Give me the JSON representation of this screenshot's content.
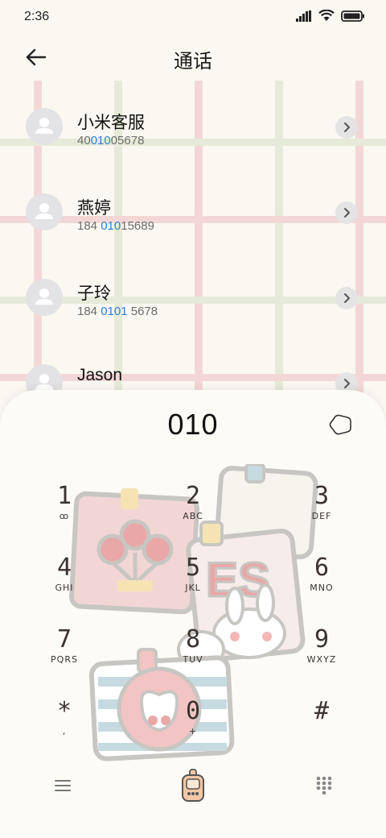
{
  "status": {
    "time": "2:36"
  },
  "header": {
    "title": "通话"
  },
  "contacts": [
    {
      "name": "小米客服",
      "num_pre": "40",
      "num_hl": "010",
      "num_post": "05678"
    },
    {
      "name": "燕婷",
      "num_pre": "184 ",
      "num_hl": "010",
      "num_post": "15689"
    },
    {
      "name": "子玲",
      "num_pre": "184 ",
      "num_hl": "0101",
      "num_post": " 5678"
    },
    {
      "name": "Jason",
      "num_pre": "",
      "num_hl": "",
      "num_post": ""
    }
  ],
  "dialpad": {
    "input": "010",
    "keys": [
      {
        "num": "1",
        "letters": "ꝏ"
      },
      {
        "num": "2",
        "letters": "ABC"
      },
      {
        "num": "3",
        "letters": "DEF"
      },
      {
        "num": "4",
        "letters": "GHI"
      },
      {
        "num": "5",
        "letters": "JKL"
      },
      {
        "num": "6",
        "letters": "MNO"
      },
      {
        "num": "7",
        "letters": "PQRS"
      },
      {
        "num": "8",
        "letters": "TUV"
      },
      {
        "num": "9",
        "letters": "WXYZ"
      },
      {
        "num": "*",
        "letters": ","
      },
      {
        "num": "0",
        "letters": "+"
      },
      {
        "num": "#",
        "letters": ""
      }
    ]
  },
  "colors": {
    "highlight": "#2b82d6",
    "background": "#fbf8f1",
    "pad": "#fdfbf6"
  },
  "icons": {
    "back": "arrow-left-icon",
    "delete": "backspace-icon",
    "menu": "menu-icon",
    "call": "call-icon",
    "dialpad": "dialpad-icon"
  }
}
